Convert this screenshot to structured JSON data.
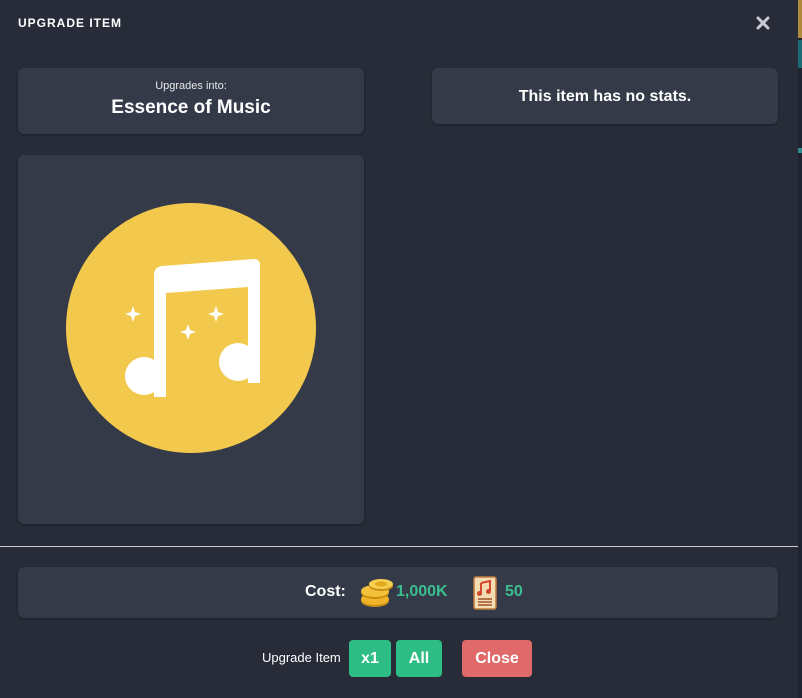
{
  "modal": {
    "title": "UPGRADE ITEM",
    "close_icon": "close-icon"
  },
  "upgrades": {
    "subtitle": "Upgrades into:",
    "item_name": "Essence of Music",
    "item_icon": "music-note-icon",
    "icon_color": "#f2c94c"
  },
  "stats": {
    "message": "This item has no stats."
  },
  "cost": {
    "label": "Cost:",
    "items": [
      {
        "icon": "gold-coins-icon",
        "value": "1,000K"
      },
      {
        "icon": "music-sheet-icon",
        "value": "50"
      }
    ],
    "value_color": "#3cbf8f"
  },
  "actions": {
    "upgrade_label": "Upgrade Item",
    "x1_label": "x1",
    "all_label": "All",
    "close_label": "Close",
    "accent_green": "#2fbd86",
    "accent_red": "#e06a6a"
  }
}
